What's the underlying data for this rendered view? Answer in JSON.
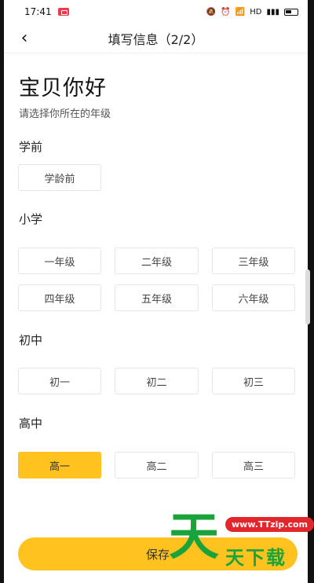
{
  "status_bar": {
    "time": "17:41",
    "network": "HD"
  },
  "nav": {
    "title": "填写信息（2/2）"
  },
  "greeting": "宝贝你好",
  "subtitle": "请选择你所在的年级",
  "sections": {
    "preschool": {
      "title": "学前",
      "options": [
        "学龄前"
      ]
    },
    "primary": {
      "title": "小学",
      "options": [
        "一年级",
        "二年级",
        "三年级",
        "四年级",
        "五年级",
        "六年级"
      ]
    },
    "junior": {
      "title": "初中",
      "options": [
        "初一",
        "初二",
        "初三"
      ]
    },
    "senior": {
      "title": "高中",
      "options": [
        "高一",
        "高二",
        "高三"
      ]
    }
  },
  "selected_grade": "高一",
  "save_label": "保存",
  "watermark": {
    "big": "天",
    "url": "www.TTzip.com",
    "small": "天下载"
  },
  "colors": {
    "accent": "#ffc21f",
    "watermark_green": "#1aa33a",
    "watermark_red": "#e3262b"
  }
}
